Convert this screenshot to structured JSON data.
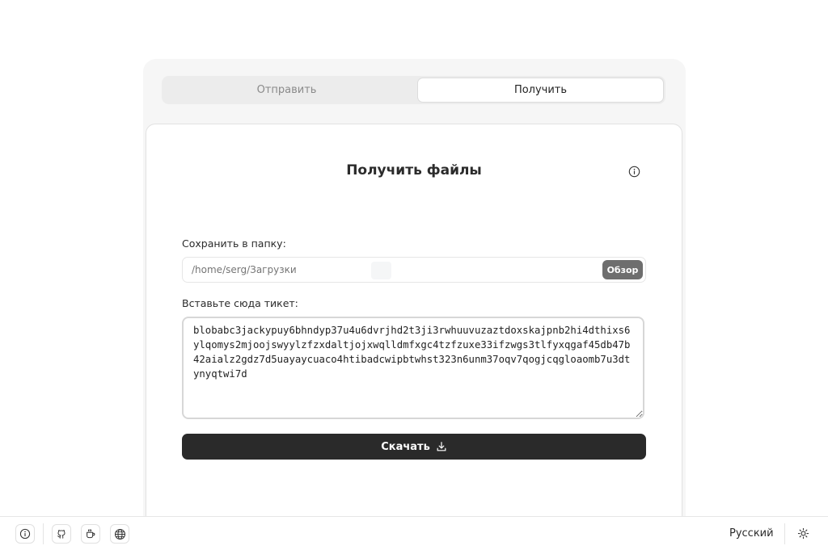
{
  "tabs": {
    "send_label": "Отправить",
    "receive_label": "Получить"
  },
  "receive": {
    "title": "Получить файлы",
    "folder_label": "Сохранить в папку:",
    "folder_placeholder": "/home/serg/Загрузки",
    "browse_label": "Обзор",
    "ticket_label": "Вставьте сюда тикет:",
    "ticket_value": "blobabc3jackypuy6bhndyp37u4u6dvrjhd2t3ji3rwhuuvuzaztdoxskajpnb2hi4dthixs6ylqomys2mjoojswyylzfzxdaltjojxwqlldmfxgc4tzfzuxe33ifzwgs3tlfyxqgaf45db47b42aialz2gdz7d5uayaycuaco4htibadcwipbtwhst323n6unm37oqv7qogjcqgloaomb7u3dtynyqtwi7d",
    "download_label": "Скачать"
  },
  "footer": {
    "icons": [
      "info-icon",
      "github-icon",
      "coffee-icon",
      "globe-icon"
    ],
    "language_label": "Русский",
    "theme_icon": "sun-icon"
  },
  "colors": {
    "accent_dark": "#2a2a2a",
    "browse_button": "#6e6e6e",
    "frame_bg": "#f6f6f6"
  }
}
